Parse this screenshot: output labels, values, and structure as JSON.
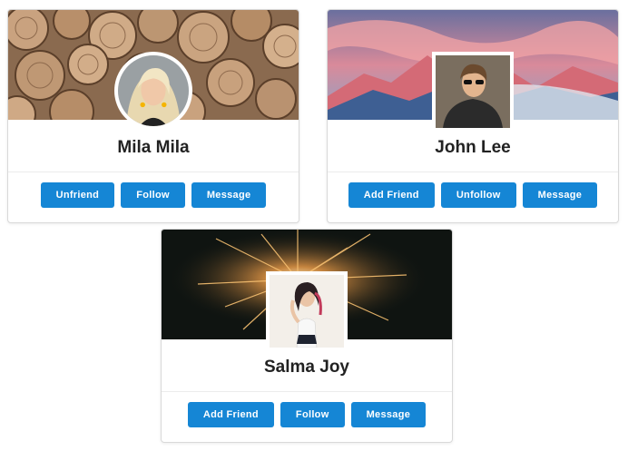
{
  "colors": {
    "button_bg": "#1586d5",
    "button_text": "#ffffff",
    "name_text": "#222222"
  },
  "cards": [
    {
      "name": "Mila Mila",
      "cover": "wood-logs-cover",
      "avatar_shape": "circle",
      "buttons": [
        "Unfriend",
        "Follow",
        "Message"
      ]
    },
    {
      "name": "John Lee",
      "cover": "pink-mountains-cover",
      "avatar_shape": "square",
      "buttons": [
        "Add Friend",
        "Unfollow",
        "Message"
      ]
    },
    {
      "name": "Salma Joy",
      "cover": "sparkler-cover",
      "avatar_shape": "square",
      "buttons": [
        "Add Friend",
        "Follow",
        "Message"
      ]
    }
  ]
}
